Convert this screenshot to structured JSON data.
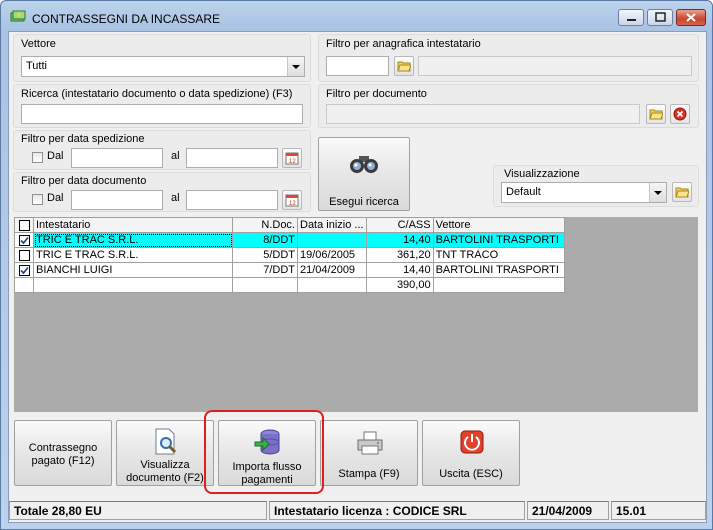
{
  "window": {
    "title": "CONTRASSEGNI DA INCASSARE"
  },
  "filters": {
    "vettore_label": "Vettore",
    "vettore_value": "Tutti",
    "anagrafica_label": "Filtro per anagrafica intestatario",
    "ricerca_label": "Ricerca (intestatario documento o data spedizione) (F3)",
    "documento_label": "Filtro per documento",
    "data_spedizione_label": "Filtro per data spedizione",
    "data_documento_label": "Filtro per data documento",
    "dal_label": "Dal",
    "al_label": "al",
    "search_button_label": "Esegui ricerca",
    "visualizzazione_label": "Visualizzazione",
    "visualizzazione_value": "Default"
  },
  "grid": {
    "headers": [
      "Intestatario",
      "N.Doc.",
      "Data inizio ...",
      "C/ASS",
      "Vettore"
    ],
    "rows": [
      {
        "checked": true,
        "intestatario": "TRIC E TRAC S.R.L.",
        "ndoc": "8/DDT",
        "data": "",
        "cass": "14,40",
        "vettore": "BARTOLINI TRASPORTI"
      },
      {
        "checked": false,
        "intestatario": "TRIC E TRAC S.R.L.",
        "ndoc": "5/DDT",
        "data": "19/06/2005",
        "cass": "361,20",
        "vettore": "TNT TRACO"
      },
      {
        "checked": true,
        "intestatario": "BIANCHI LUIGI",
        "ndoc": "7/DDT",
        "data": "21/04/2009",
        "cass": "14,40",
        "vettore": "BARTOLINI TRASPORTI"
      }
    ],
    "total_cass": "390,00"
  },
  "toolbar": {
    "contrassegno_line1": "Contrassegno",
    "contrassegno_line2": "pagato (F12)",
    "visualizza_line1": "Visualizza",
    "visualizza_line2": "documento (F2)",
    "importa_line1": "Importa flusso",
    "importa_line2": "pagamenti",
    "stampa_label": "Stampa (F9)",
    "uscita_label": "Uscita (ESC)"
  },
  "status": {
    "totale": "Totale 28,80 EU",
    "licenza": "Intestatario licenza : CODICE SRL",
    "date": "21/04/2009",
    "time": "15.01"
  },
  "colors": {
    "selected_row": "#00ffff",
    "highlight": "#e01e1e"
  }
}
